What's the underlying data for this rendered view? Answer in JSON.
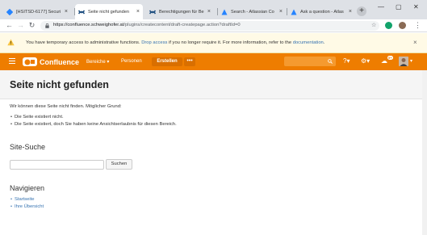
{
  "browser": {
    "tabs": [
      {
        "title": "[HSITSD-6177] Securi",
        "icon": "jira-icon",
        "active": false
      },
      {
        "title": "Seite nicht gefunden",
        "icon": "confluence-icon",
        "active": true
      },
      {
        "title": "Berechtigungen für Be",
        "icon": "confluence-icon",
        "active": false
      },
      {
        "title": "Search - Atlassian Co",
        "icon": "atlassian-icon",
        "active": false
      },
      {
        "title": "Ask a question - Atlas",
        "icon": "atlassian-icon",
        "active": false
      }
    ],
    "new_tab": "+",
    "close_glyph": "×",
    "url_host": "https://confluence.schweighofer.at",
    "url_path": "/plugins/createcontent/draft-createpage.action?draftId=0"
  },
  "banner": {
    "text_before": "You have temporary access to administrative functions.",
    "text_link1": "Drop access",
    "text_mid": "if you no longer require it. For more information, refer to the",
    "text_link2": "documentation",
    "text_end": "."
  },
  "header": {
    "logo_text": "Confluence",
    "nav_spaces": "Bereiche ▾",
    "nav_people": "Personen",
    "create": "Erstellen",
    "more": "•••",
    "notification_count": "9+",
    "accent": "#ee7d00"
  },
  "page": {
    "title": "Seite nicht gefunden",
    "intro": "Wir können diese Seite nicht finden. Möglicher Grund:",
    "reasons": [
      "Die Seite existiert nicht.",
      "Die Seite existiert, doch Sie haben keine Ansichtserlaubnis für diesen Bereich."
    ],
    "search_heading": "Site-Suche",
    "search_button": "Suchen",
    "search_value": "",
    "navigate_heading": "Navigieren",
    "nav_links": [
      "Startseite",
      "Ihre Übersicht"
    ]
  }
}
